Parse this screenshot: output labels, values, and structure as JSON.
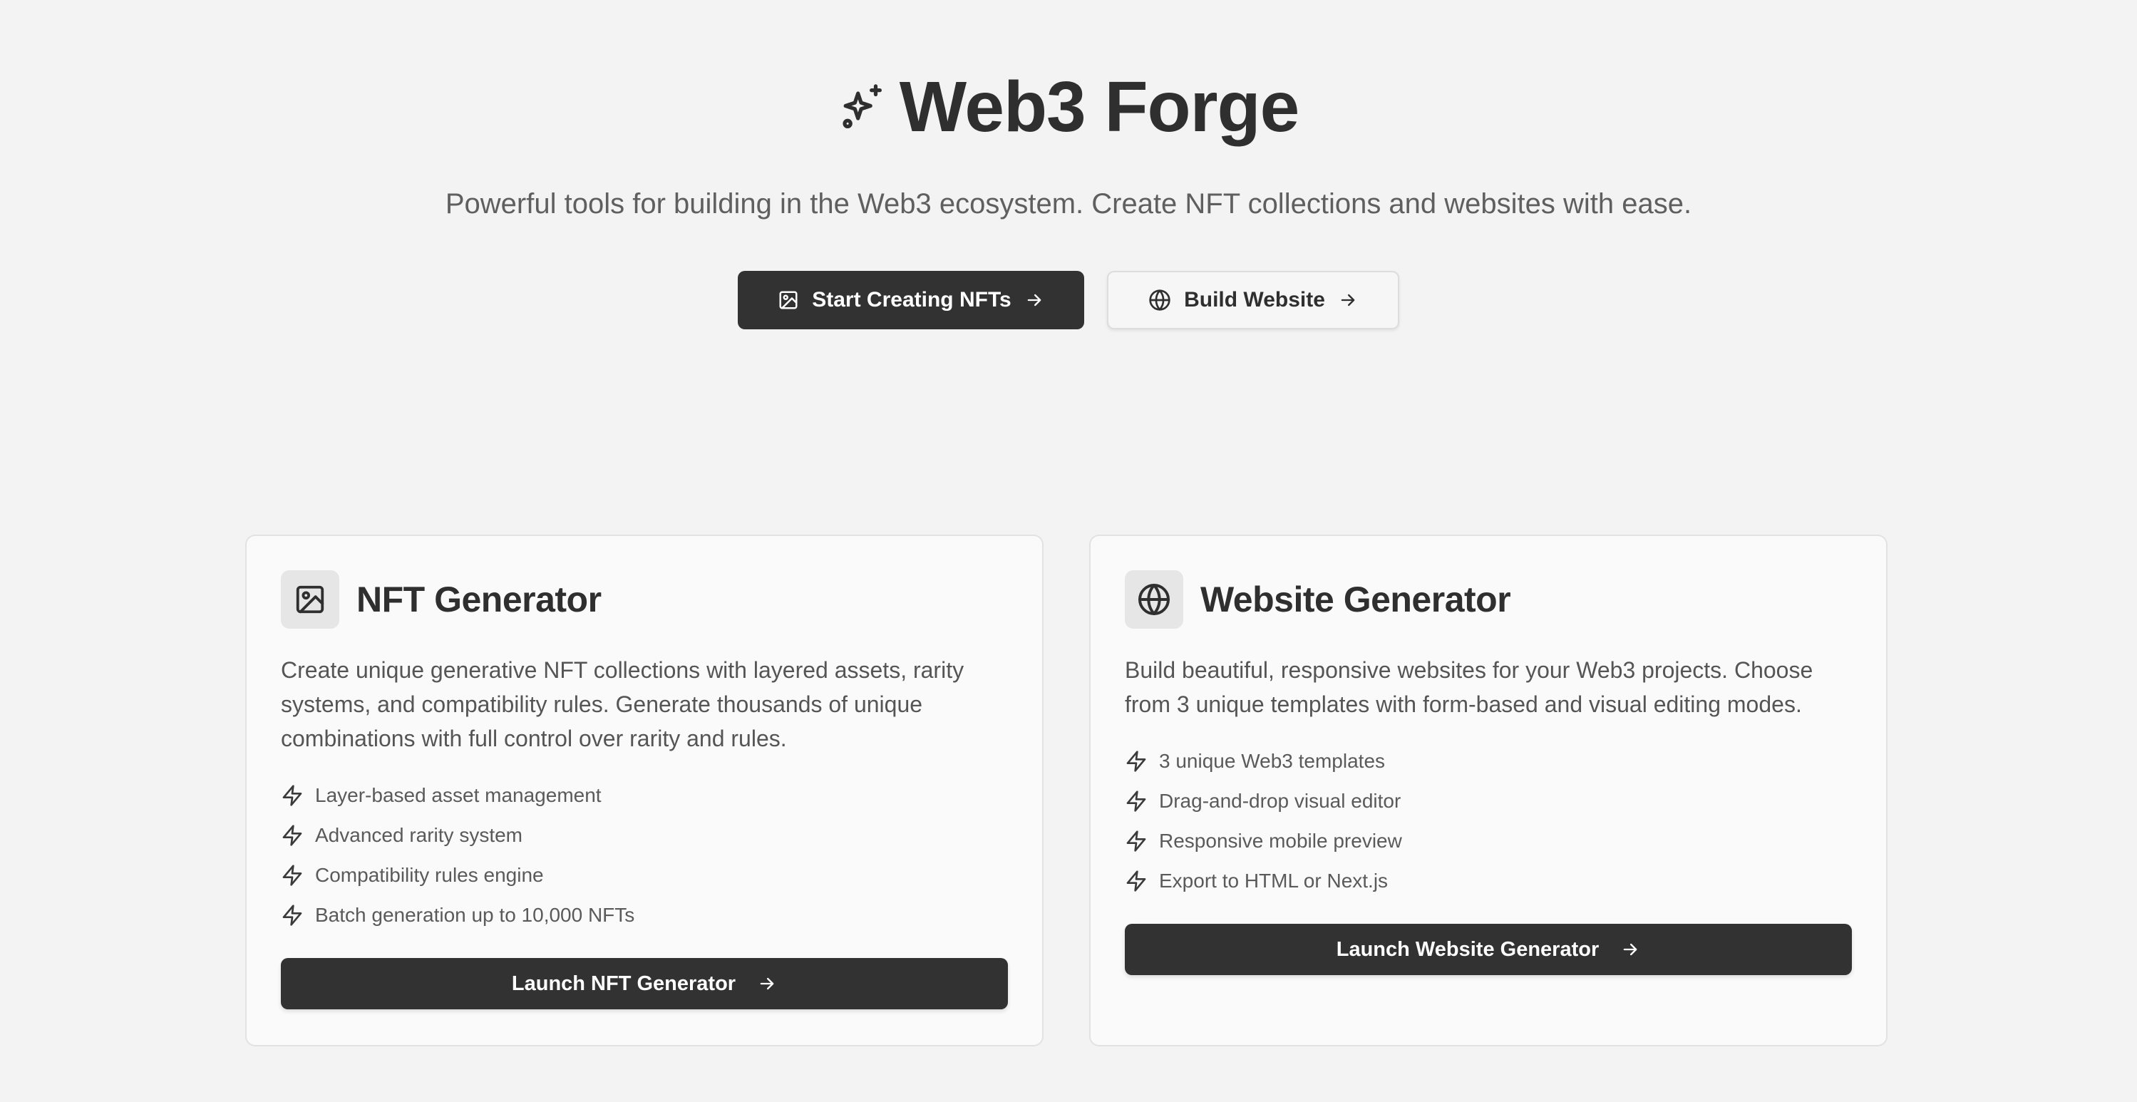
{
  "hero": {
    "title": "Web3 Forge",
    "title_icon": "sparkles-icon",
    "subtitle": "Powerful tools for building in the Web3 ecosystem. Create NFT collections and websites with ease.",
    "primary_cta": {
      "label": "Start Creating NFTs",
      "icon": "image-icon",
      "trailing_icon": "arrow-right-icon"
    },
    "secondary_cta": {
      "label": "Build Website",
      "icon": "globe-icon",
      "trailing_icon": "arrow-right-icon"
    }
  },
  "cards": [
    {
      "title": "NFT Generator",
      "icon": "image-icon",
      "description": "Create unique generative NFT collections with layered assets, rarity systems, and compatibility rules. Generate thousands of unique combinations with full control over rarity and rules.",
      "features": [
        "Layer-based asset management",
        "Advanced rarity system",
        "Compatibility rules engine",
        "Batch generation up to 10,000 NFTs"
      ],
      "button_label": "Launch NFT Generator"
    },
    {
      "title": "Website Generator",
      "icon": "globe-icon",
      "description": "Build beautiful, responsive websites for your Web3 projects. Choose from 3 unique templates with form-based and visual editing modes.",
      "features": [
        "3 unique Web3 templates",
        "Drag-and-drop visual editor",
        "Responsive mobile preview",
        "Export to HTML or Next.js"
      ],
      "button_label": "Launch Website Generator"
    }
  ],
  "colors": {
    "background": "#f3f3f3",
    "primary": "#323232",
    "card": "#fafafa",
    "text": "#2f2f2f",
    "muted": "#5a5a5a"
  }
}
